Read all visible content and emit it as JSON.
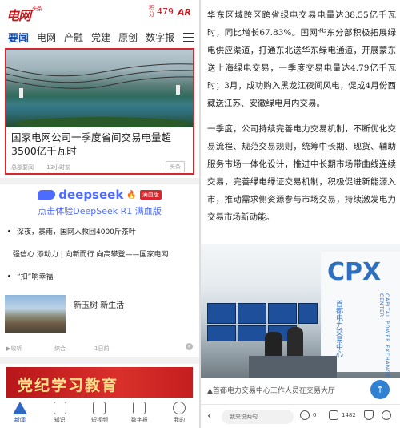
{
  "left": {
    "header": {
      "logo_text": "电网",
      "logo_sub": "头条",
      "score_label": "积分",
      "score_value": "479",
      "ar_label": "AR"
    },
    "tabs": [
      {
        "label": "要闻"
      },
      {
        "label": "电网"
      },
      {
        "label": "产融"
      },
      {
        "label": "党建"
      },
      {
        "label": "原创"
      },
      {
        "label": "数字报"
      }
    ],
    "hero": {
      "title": "国家电网公司一季度省间交易电量超3500亿千瓦时",
      "source": "总部要闻",
      "time": "13小时前",
      "tag": "头条"
    },
    "deepseek": {
      "name": "deepseek",
      "badge": "满血版",
      "subtitle": "点击体验DeepSeek R1 满血版"
    },
    "news": [
      "深夜，暴雨，国网人救回4000斤茶叶",
      "强信心 添动力 | 向新而行 向高攀登——国家电网",
      "“扣”响幸福"
    ],
    "feature": {
      "title": "新玉树 新生活",
      "action": "▶收听",
      "category": "综合",
      "time": "1日前"
    },
    "banner_text": "党纪学习教育",
    "bottom_nav": [
      {
        "label": "新闻"
      },
      {
        "label": "知识"
      },
      {
        "label": "短视频"
      },
      {
        "label": "数字报"
      },
      {
        "label": "我的"
      }
    ]
  },
  "right": {
    "paragraph1": "华东区域跨区跨省绿电交易电量达38.55亿千瓦时，同比增长67.83%。国网华东分部积极拓展绿电供应渠道，打通东北送华东绿电通道，开展蒙东送上海绿电交易，一季度交易电量达4.79亿千瓦时；3月，成功购入黑龙江夜间风电，促成4月份西藏送江苏、安徽绿电月内交易。",
    "paragraph2": "一季度，公司持续完善电力交易机制，不断优化交易流程、规范交易规则，统筹中长期、现货、辅助服务市场一体化设计，推进中长期市场带曲线连续交易，完善绿电绿证交易机制，积极促进新能源入市，推动需求侧资源参与市场交易，持续激发电力交易市场新动能。",
    "photo": {
      "sign_logo": "CPX",
      "sign_cn": "首都电力交易中心",
      "sign_en": "CAPITAL POWER EXCHANGE CENTER"
    },
    "caption": "▲首都电力交易中心工作人员在交易大厅",
    "bottom": {
      "comment_placeholder": "我来说两句...",
      "comments": "0",
      "likes": "1482"
    }
  }
}
